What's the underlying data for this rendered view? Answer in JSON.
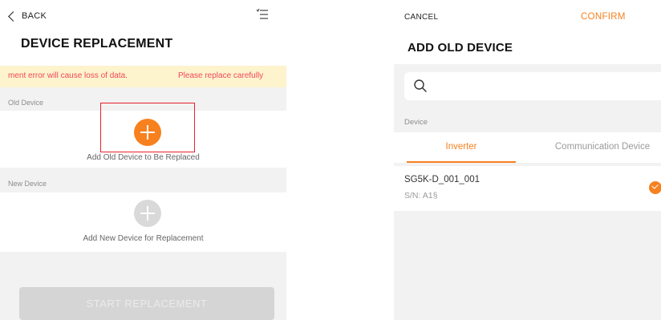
{
  "left": {
    "back_label": "BACK",
    "title": "DEVICE REPLACEMENT",
    "warning": {
      "part1": "ment error will cause loss of data.",
      "part2": "Please replace carefully"
    },
    "old_device": {
      "section_label": "Old Device",
      "add_caption": "Add Old Device to Be Replaced"
    },
    "new_device": {
      "section_label": "New Device",
      "add_caption": "Add New Device for Replacement"
    },
    "start_button_label": "START REPLACEMENT"
  },
  "right": {
    "cancel_label": "CANCEL",
    "confirm_label": "CONFIRM",
    "title": "ADD OLD DEVICE",
    "search": {
      "placeholder": ""
    },
    "section_label": "Device",
    "tabs": [
      {
        "label": "Inverter",
        "active": true
      },
      {
        "label": "Communication Device",
        "active": false
      }
    ],
    "devices": [
      {
        "name": "SG5K-D_001_001",
        "sn": "S/N: A1§",
        "selected": true
      }
    ]
  },
  "icons": {
    "back": "chevron-left-icon",
    "menu": "menu-list-icon",
    "add_old": "plus-circle-icon",
    "add_new": "plus-circle-icon",
    "search": "search-icon",
    "selected": "check-circle-icon"
  },
  "colors": {
    "accent": "#f7801f",
    "warning_bg": "#fdf3cd",
    "warning_text": "#f2485a",
    "highlight": "#e8212b"
  }
}
